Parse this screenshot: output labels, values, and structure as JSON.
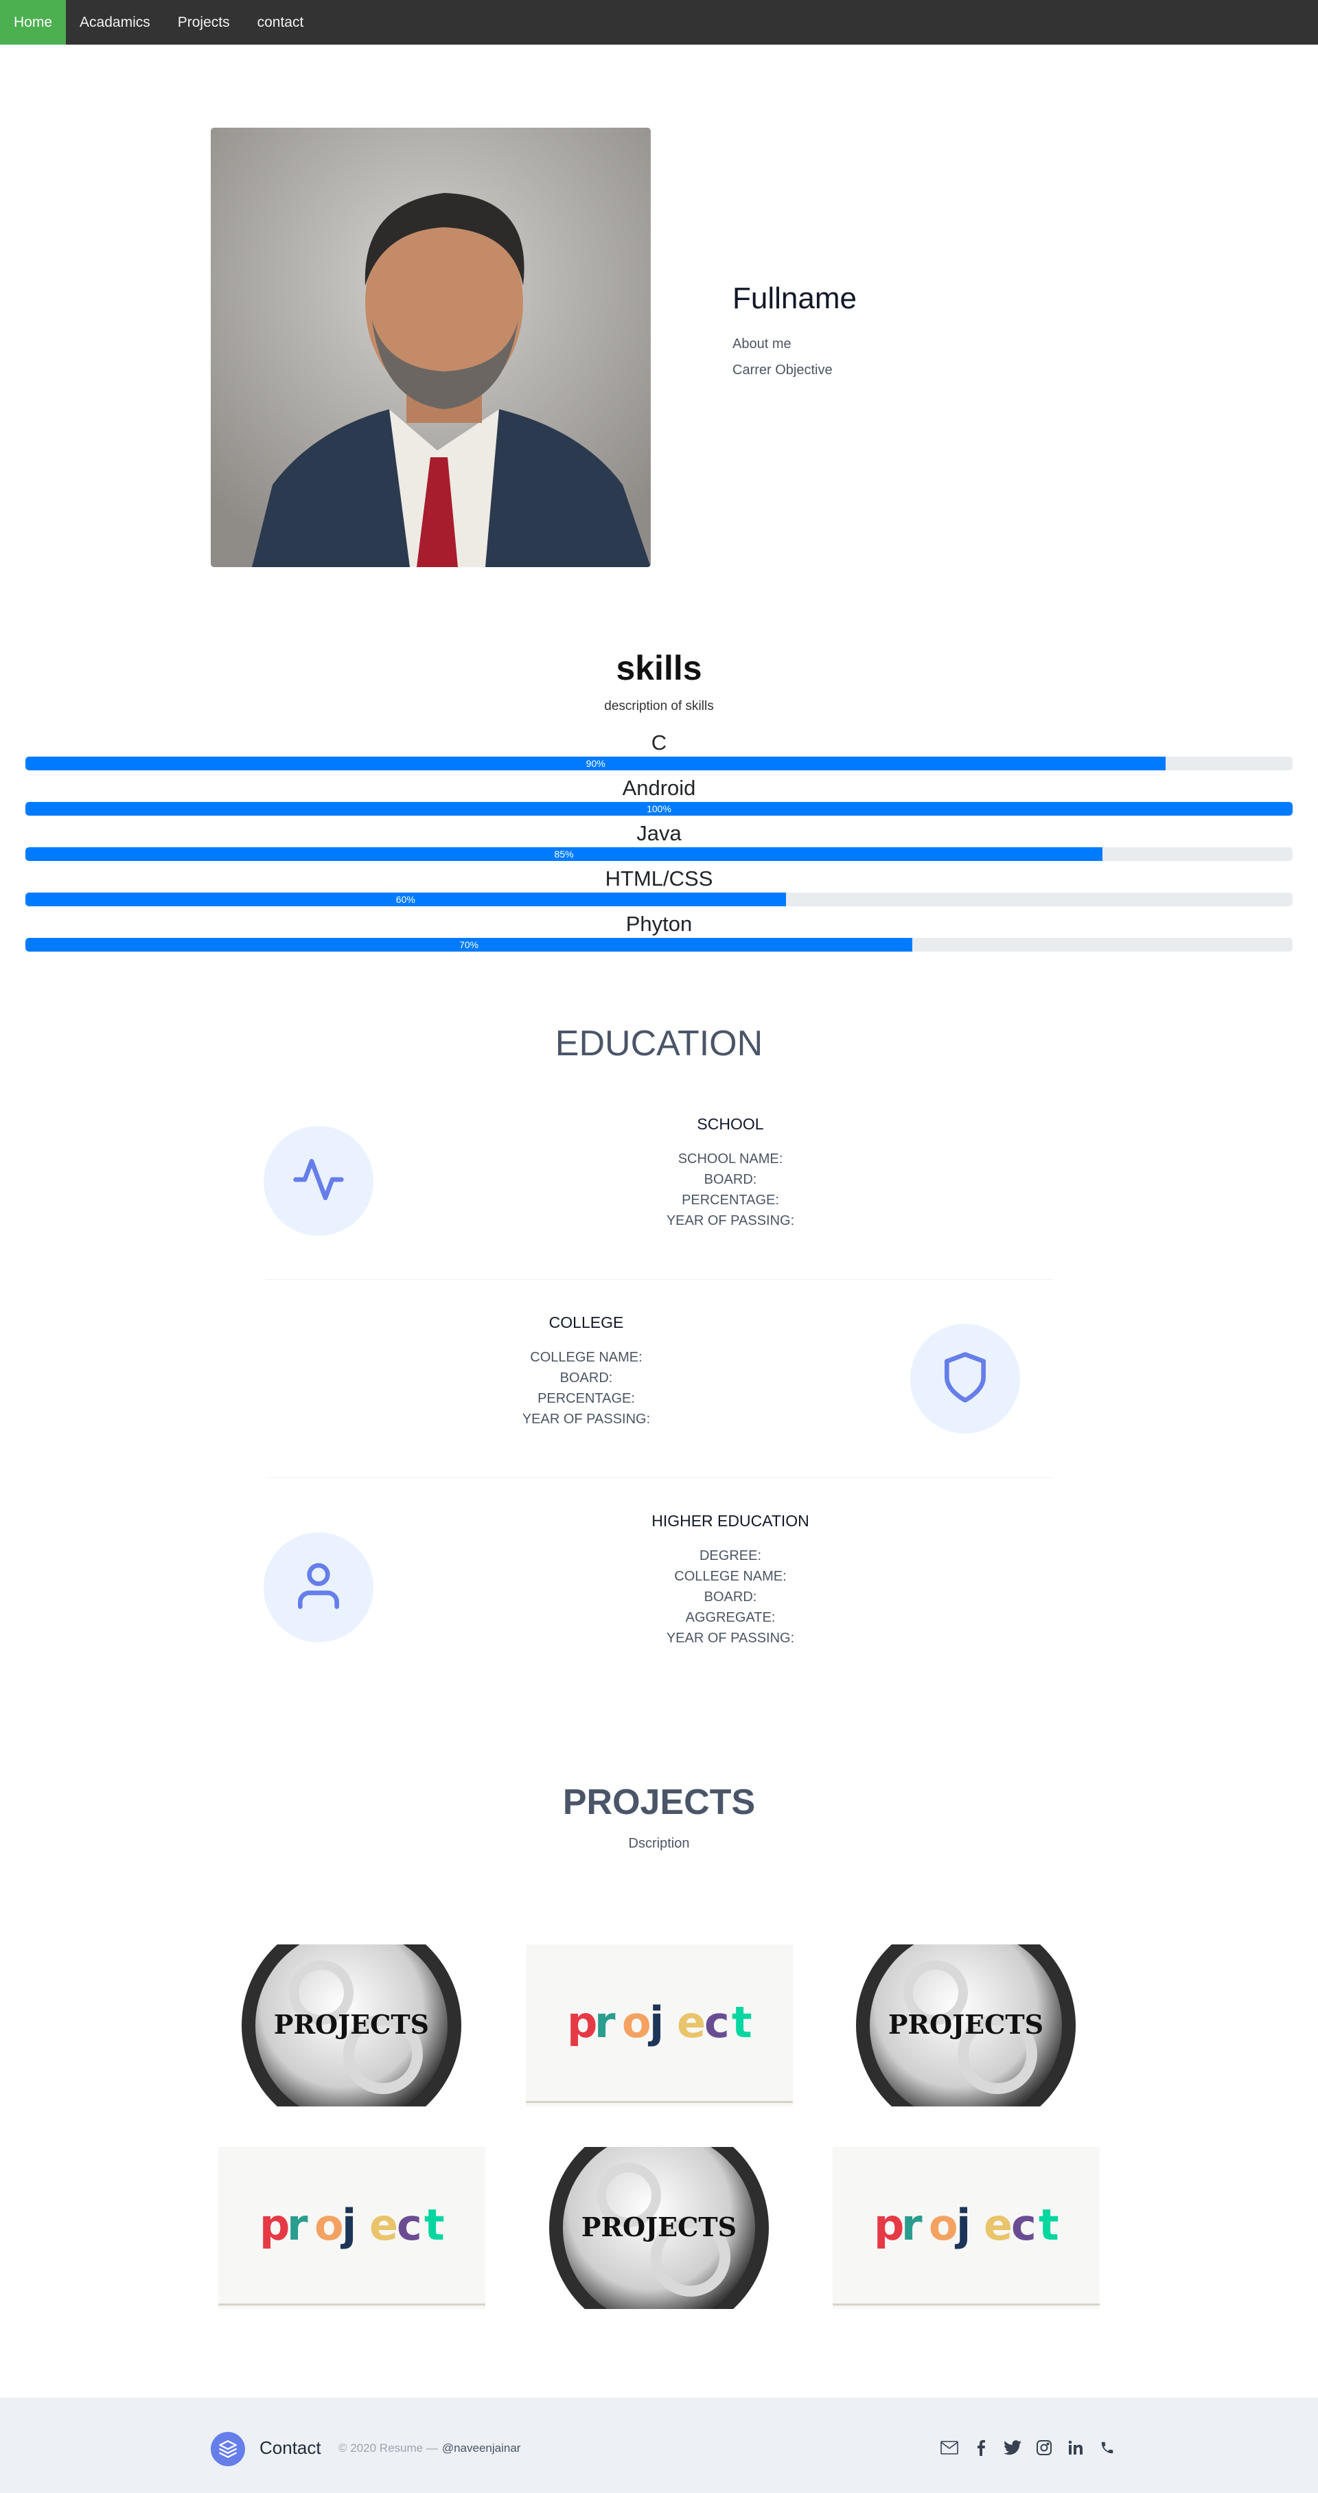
{
  "nav": {
    "items": [
      {
        "label": "Home",
        "active": true
      },
      {
        "label": "Acadamics",
        "active": false
      },
      {
        "label": "Projects",
        "active": false
      },
      {
        "label": "contact",
        "active": false
      }
    ]
  },
  "hero": {
    "name": "Fullname",
    "about": "About me",
    "objective": "Carrer Objective"
  },
  "skills": {
    "title": "skills",
    "description": "description of skills",
    "items": [
      {
        "name": "C",
        "percent": 90,
        "label": "90%"
      },
      {
        "name": "Android",
        "percent": 100,
        "label": "100%"
      },
      {
        "name": "Java",
        "percent": 85,
        "label": "85%"
      },
      {
        "name": "HTML/CSS",
        "percent": 60,
        "label": "60%"
      },
      {
        "name": "Phyton",
        "percent": 70,
        "label": "70%"
      }
    ]
  },
  "education": {
    "title": "EDUCATION",
    "school": {
      "heading": "SCHOOL",
      "fields": [
        "SCHOOL NAME:",
        "BOARD:",
        "PERCENTAGE:",
        "YEAR OF PASSING:"
      ],
      "icon": "activity-icon"
    },
    "college": {
      "heading": "COLLEGE",
      "fields": [
        "COLLEGE NAME:",
        "BOARD:",
        "PERCENTAGE:",
        "YEAR OF PASSING:"
      ],
      "icon": "shield-icon"
    },
    "higher": {
      "heading": "HIGHER EDUCATION",
      "fields": [
        "DEGREE:",
        "COLLEGE NAME:",
        "BOARD:",
        "AGGREGATE:",
        "YEAR OF PASSING:"
      ],
      "icon": "user-icon"
    }
  },
  "projects": {
    "title": "PROJECTS",
    "description": "Dscription",
    "images": [
      {
        "kind": "gear",
        "text": "PROJECTS"
      },
      {
        "kind": "colorful",
        "text": "project"
      },
      {
        "kind": "gear",
        "text": "PROJECTS"
      },
      {
        "kind": "colorful",
        "text": "project"
      },
      {
        "kind": "gear",
        "text": "PROJECTS"
      },
      {
        "kind": "colorful",
        "text": "project"
      }
    ]
  },
  "footer": {
    "brand": "Contact",
    "copyright": "© 2020 Resume —",
    "handle": "@naveenjainar",
    "social": [
      "mail-icon",
      "facebook-icon",
      "twitter-icon",
      "instagram-icon",
      "linkedin-icon",
      "phone-icon"
    ]
  },
  "colors": {
    "nav_bg": "#333333",
    "nav_active": "#4CAF50",
    "progress": "#007bff",
    "accent": "#667eea"
  }
}
